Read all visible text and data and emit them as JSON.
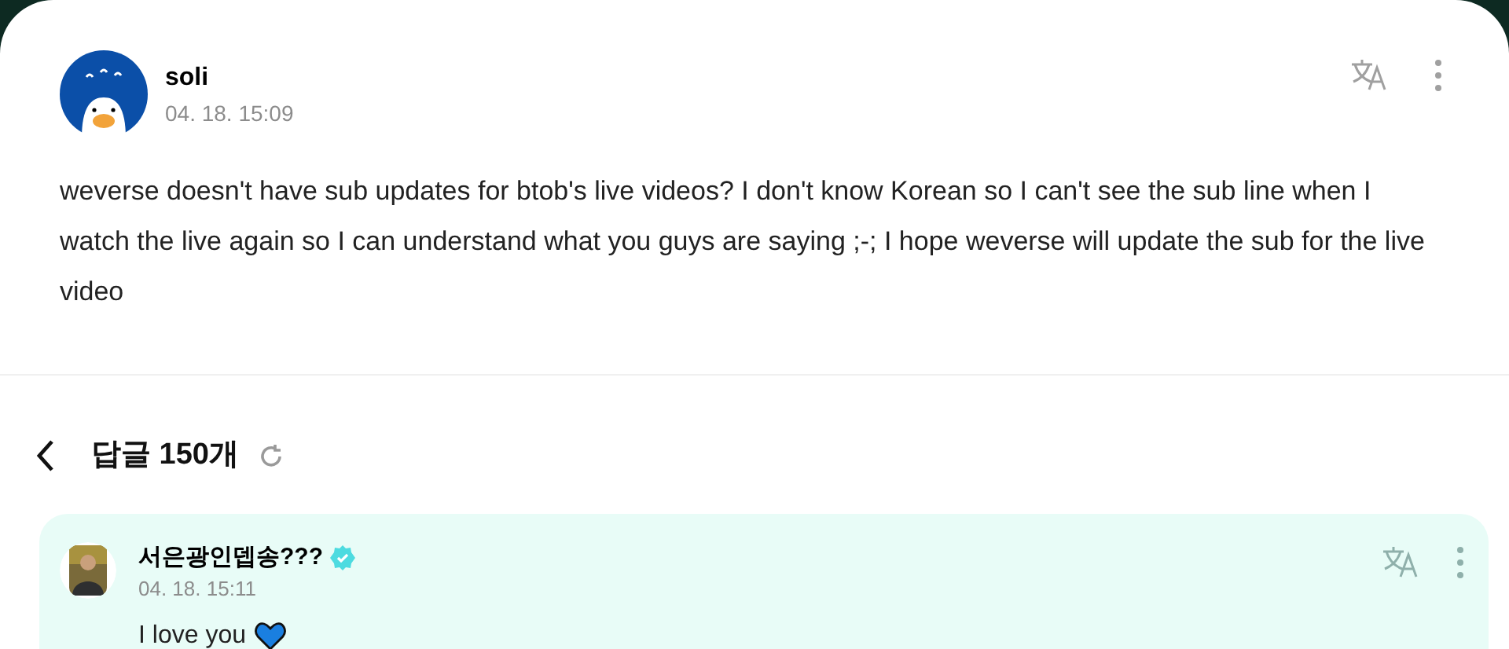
{
  "post": {
    "author": "soli",
    "time": "04. 18. 15:09",
    "body": "weverse doesn't have sub updates for btob's live videos? I don't know Korean so I can't see the sub line when I watch the live again so I can understand what you guys are saying ;-; I hope weverse will update the sub for the live video"
  },
  "replies_header": {
    "title": "답글 150개"
  },
  "replies": [
    {
      "author": "서은광인뎁송???",
      "verified": true,
      "time": "04. 18. 15:11",
      "body": "I love you"
    }
  ]
}
